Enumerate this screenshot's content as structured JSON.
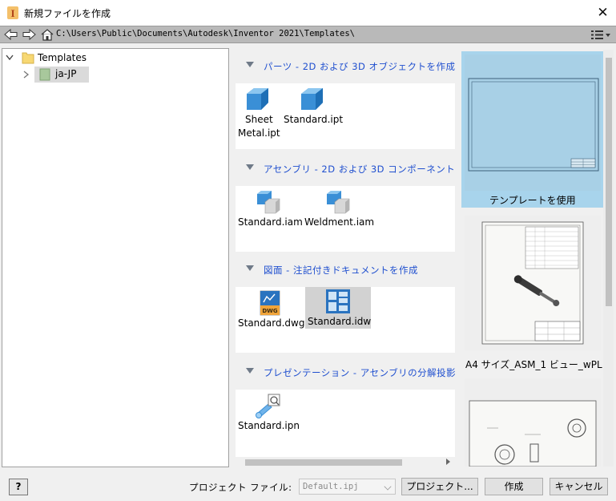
{
  "window": {
    "title": "新規ファイルを作成",
    "close_glyph": "✕"
  },
  "address": {
    "path": "C:\\Users\\Public\\Documents\\Autodesk\\Inventor 2021\\Templates\\"
  },
  "tree": {
    "root_label": "Templates",
    "child_label": "ja-JP"
  },
  "sections": [
    {
      "title": "パーツ - 2D および 3D オブジェクトを作成",
      "items": [
        {
          "line1": "Sheet",
          "line2": "Metal.ipt",
          "icon": "part-cube-icon"
        },
        {
          "line1": "Standard.ipt",
          "icon": "part-cube-icon"
        }
      ]
    },
    {
      "title": "アセンブリ - 2D および 3D コンポーネント",
      "items": [
        {
          "line1": "Standard.iam",
          "icon": "assembly-icon"
        },
        {
          "line1": "Weldment.iam",
          "icon": "assembly-icon"
        }
      ]
    },
    {
      "title": "図面 - 注記付きドキュメントを作成",
      "items": [
        {
          "line1": "Standard.dwg",
          "icon": "dwg-drawing-icon"
        },
        {
          "line1": "Standard.idw",
          "icon": "idw-drawing-icon",
          "selected": true
        }
      ]
    },
    {
      "title": "プレゼンテーション - アセンブリの分解投影",
      "items": [
        {
          "line1": "Standard.ipn",
          "icon": "presentation-icon"
        }
      ]
    }
  ],
  "previews": [
    {
      "label": "テンプレートを使用",
      "selected": true
    },
    {
      "label": "A4 サイズ_ASM_1 ビュー_wPL"
    },
    {
      "label": ""
    }
  ],
  "bottom": {
    "help_label": "?",
    "project_label": "プロジェクト ファイル:",
    "project_value": "Default.ipj",
    "projects_button": "プロジェクト...",
    "create_button": "作成",
    "cancel_button": "キャンセル"
  },
  "colors": {
    "section_title": "#1f4fcf",
    "selected_preview": "#a8d4ec",
    "selected_tile": "#d2d2d2",
    "address_bar": "#b9b9b9"
  }
}
